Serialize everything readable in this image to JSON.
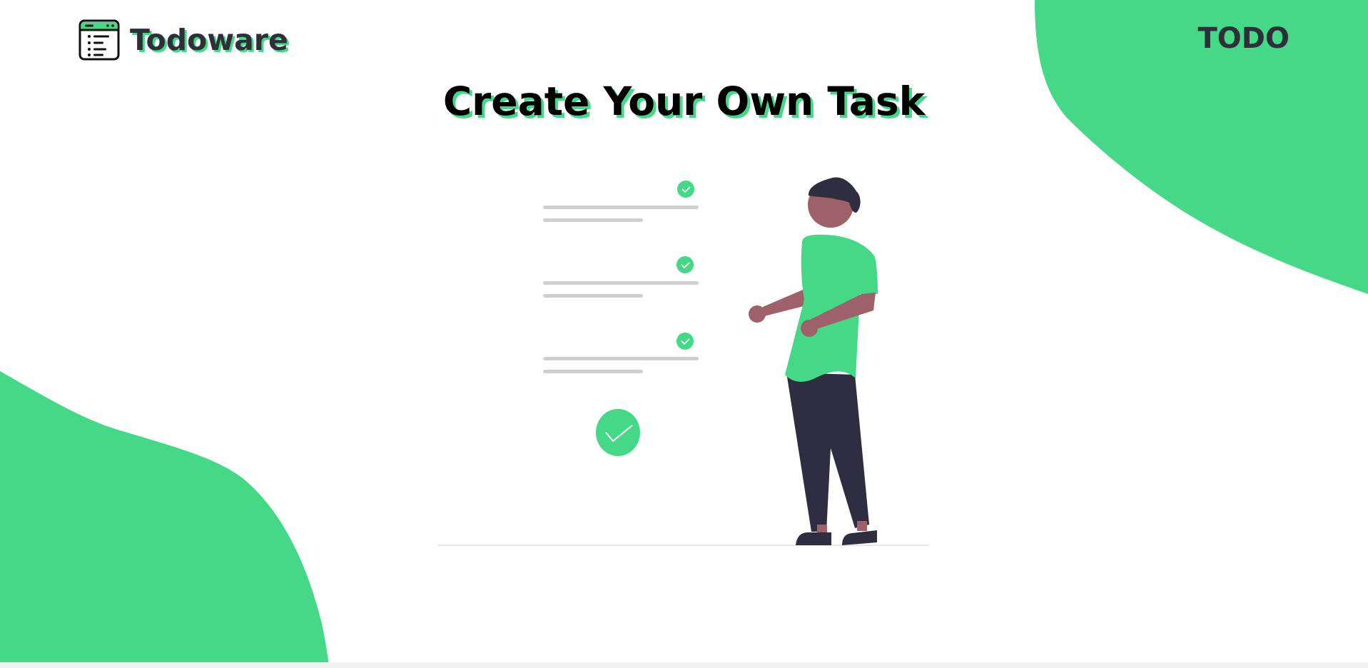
{
  "header": {
    "brand": {
      "name": "Todoware",
      "logo_icon": "todo-list-window-icon"
    },
    "nav": {
      "todo_label": "TODO"
    }
  },
  "hero": {
    "title": "Create Your Own Task",
    "illustration": {
      "description_icon": "checklist-person-illustration",
      "checklist_items_count": 3
    }
  },
  "colors": {
    "accent": "#45d887",
    "text_dark": "#2f2f3a",
    "title": "#000000",
    "checklist_line": "#cfcfcf",
    "skin": "#9e616a",
    "pants": "#2f2e41"
  }
}
